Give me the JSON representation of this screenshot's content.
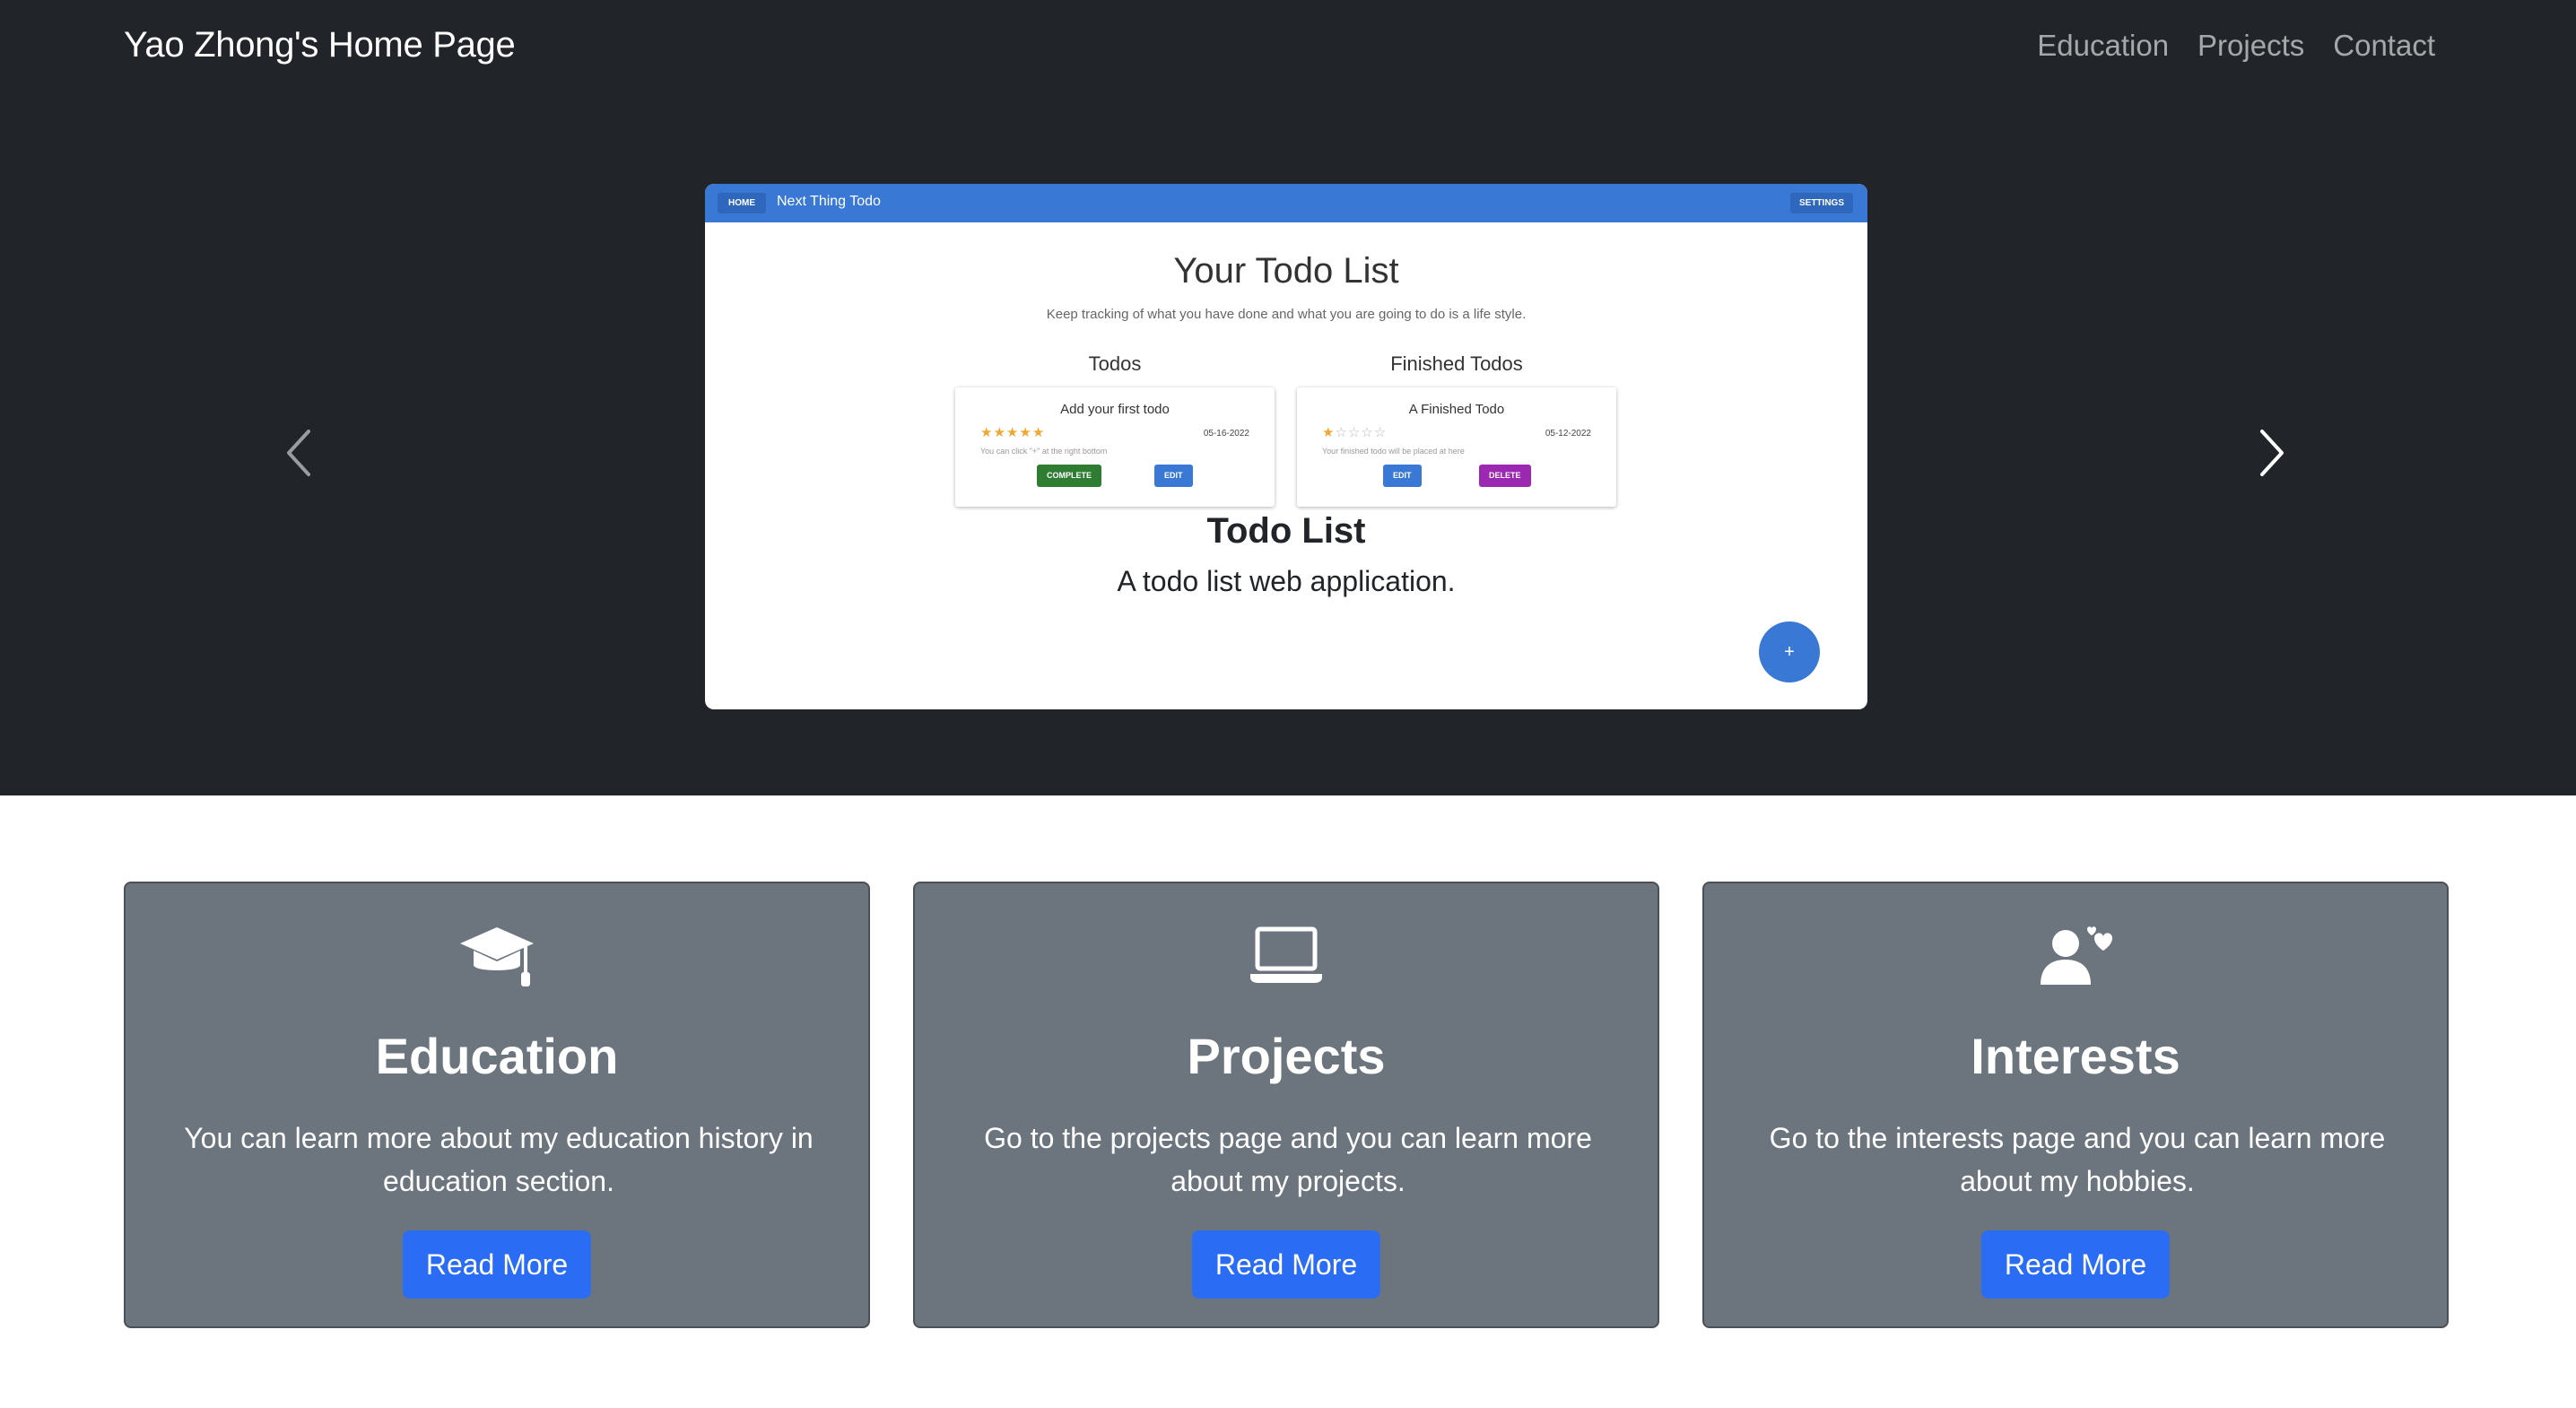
{
  "navbar": {
    "brand": "Yao Zhong's Home Page",
    "links": [
      "Education",
      "Projects",
      "Contact"
    ]
  },
  "carousel": {
    "slide": {
      "app_bar": {
        "home_label": "HOME",
        "title": "Next Thing Todo",
        "settings_label": "SETTINGS"
      },
      "heading": "Your Todo List",
      "subtitle": "Keep tracking of what you have done and what you are going to do is a life style.",
      "todos_title": "Todos",
      "finished_title": "Finished Todos",
      "todo_card": {
        "title": "Add your first todo",
        "rating": 5,
        "date": "05-16-2022",
        "note": "You can click \"+\" at the right bottom",
        "complete_label": "COMPLETE",
        "edit_label": "EDIT"
      },
      "finished_card": {
        "title": "A Finished Todo",
        "rating": 1,
        "date": "05-12-2022",
        "note": "Your finished todo will be placed at here",
        "edit_label": "EDIT",
        "delete_label": "DELETE"
      },
      "fab_label": "+"
    },
    "caption": {
      "title": "Todo List",
      "text": "A todo list web application."
    }
  },
  "features": [
    {
      "icon": "graduation-cap-icon",
      "title": "Education",
      "text": "You can learn more about my education history in education section.",
      "button": "Read More"
    },
    {
      "icon": "laptop-icon",
      "title": "Projects",
      "text": "Go to the projects page and you can learn more about my projects.",
      "button": "Read More"
    },
    {
      "icon": "user-heart-icon",
      "title": "Interests",
      "text": "Go to the interests page and you can learn more about my hobbies.",
      "button": "Read More"
    }
  ],
  "colors": {
    "nav_bg": "#212529",
    "card_bg": "#6c757d",
    "button": "#2a6df4",
    "app_bar": "#3a78d6"
  }
}
